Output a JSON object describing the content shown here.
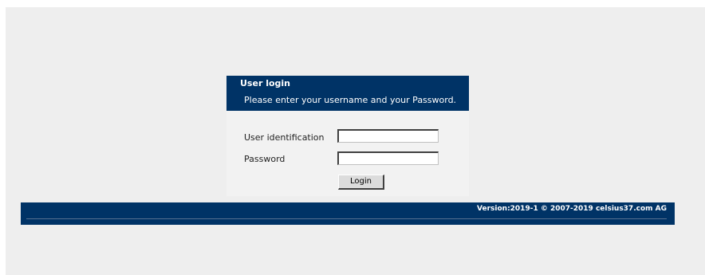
{
  "login": {
    "title": "User login",
    "subtitle": "Please enter your username and your Password.",
    "user_label": "User identification",
    "user_value": "",
    "password_label": "Password",
    "password_value": "",
    "button_label": "Login"
  },
  "footer": {
    "version": "Version:2019-1 © 2007-2019 celsius37.com AG"
  },
  "colors": {
    "brand": "#003366",
    "page_background": "#eeeeee",
    "panel_background": "#f2f2f2"
  }
}
